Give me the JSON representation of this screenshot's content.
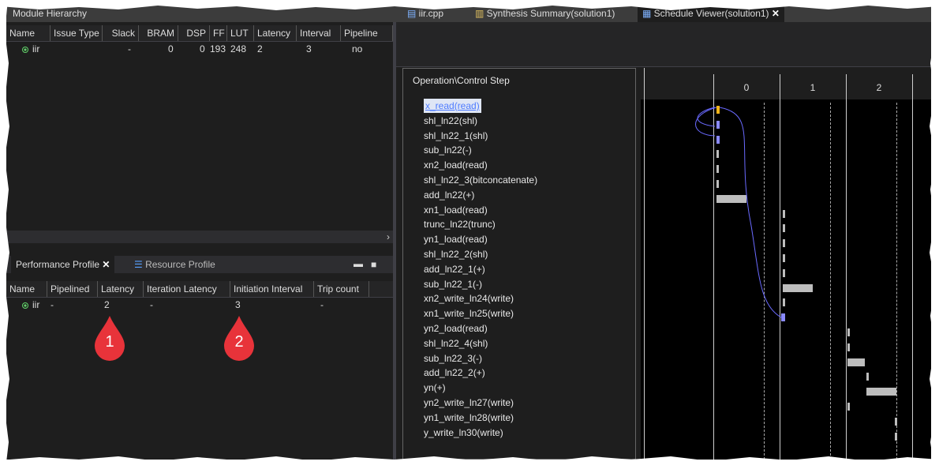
{
  "top_tabs": {
    "left_title": "Module Hierarchy",
    "files": [
      {
        "label": "iir.cpp"
      },
      {
        "label": "Synthesis Summary(solution1)"
      },
      {
        "label": "Schedule Viewer(solution1)"
      }
    ]
  },
  "hierarchy_table": {
    "headers": [
      "Name",
      "Issue Type",
      "Slack",
      "BRAM",
      "DSP",
      "FF",
      "LUT",
      "Latency",
      "Interval",
      "Pipeline"
    ],
    "row": [
      "iir",
      "",
      "-",
      "0",
      "0",
      "193",
      "248",
      "2",
      "3",
      "no"
    ]
  },
  "profile_tabs": {
    "active": "Performance Profile",
    "inactive": "Resource Profile"
  },
  "profile_table": {
    "headers": [
      "Name",
      "Pipelined",
      "Latency",
      "Iteration Latency",
      "Initiation Interval",
      "Trip count"
    ],
    "row": [
      "iir",
      "-",
      "2",
      "-",
      "3",
      "-"
    ]
  },
  "callouts": [
    "1",
    "2"
  ],
  "schedule": {
    "header": "Operation\\Control Step",
    "control_steps": [
      "0",
      "1",
      "2"
    ],
    "operations": [
      {
        "name": "x_read(read)",
        "selected": true
      },
      {
        "name": "shl_ln22(shl)"
      },
      {
        "name": "shl_ln22_1(shl)"
      },
      {
        "name": "sub_ln22(-)"
      },
      {
        "name": "xn2_load(read)"
      },
      {
        "name": "shl_ln22_3(bitconcatenate)"
      },
      {
        "name": "add_ln22(+)"
      },
      {
        "name": "xn1_load(read)"
      },
      {
        "name": "trunc_ln22(trunc)"
      },
      {
        "name": "yn1_load(read)"
      },
      {
        "name": "shl_ln22_2(shl)"
      },
      {
        "name": "add_ln22_1(+)"
      },
      {
        "name": "sub_ln22_1(-)"
      },
      {
        "name": "xn2_write_ln24(write)"
      },
      {
        "name": "xn1_write_ln25(write)"
      },
      {
        "name": "yn2_load(read)"
      },
      {
        "name": "shl_ln22_4(shl)"
      },
      {
        "name": "sub_ln22_3(-)"
      },
      {
        "name": "add_ln22_2(+)"
      },
      {
        "name": "yn(+)"
      },
      {
        "name": "yn2_write_ln27(write)"
      },
      {
        "name": "yn1_write_ln28(write)"
      },
      {
        "name": "y_write_ln30(write)"
      }
    ]
  }
}
